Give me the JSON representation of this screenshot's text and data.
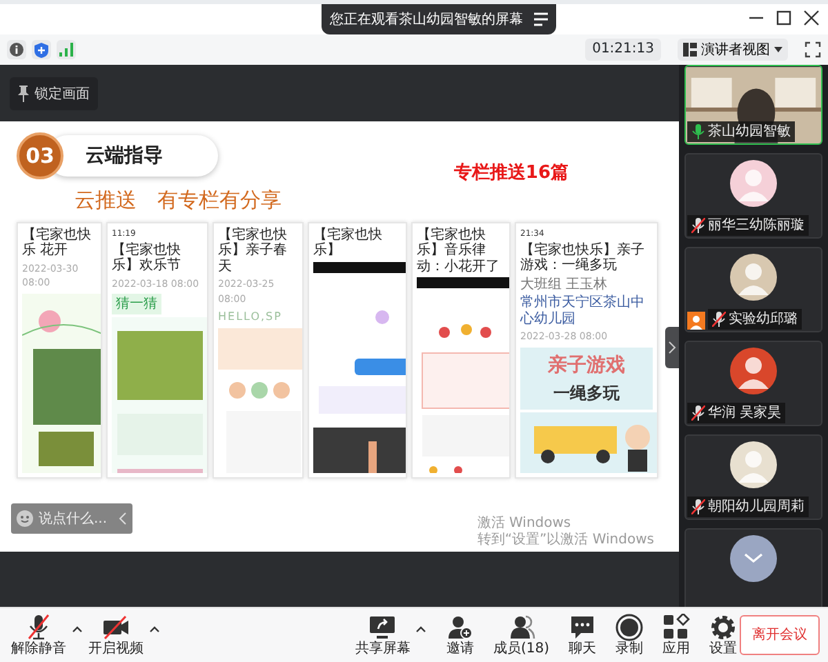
{
  "banner": {
    "text": "您正在观看茶山幼园智敏的屏幕"
  },
  "toolbar": {
    "timer": "01:21:13",
    "view": "演讲者视图"
  },
  "lock_button": {
    "label": "锁定画面"
  },
  "slide": {
    "number": "03",
    "section": "云端指导",
    "subtitle": "云推送　有专栏有分享",
    "highlight": "专栏推送16篇",
    "articles": [
      {
        "title": "【宅家也快乐 花开",
        "date": "2022-03-30 08:00"
      },
      {
        "status_time": "11:19",
        "title": "【宅家也快乐】欢乐节",
        "date": "2022-03-18 08:00",
        "tag": "猜一猜"
      },
      {
        "title": "【宅家也快乐】亲子春天",
        "date": "2022-03-25 08:00",
        "tag": "HELLO,SP"
      },
      {
        "title": "【宅家也快乐】"
      },
      {
        "title": "【宅家也快乐】音乐律动：小花开了"
      },
      {
        "status_time": "21:34",
        "title": "【宅家也快乐】亲子游戏：一绳多玩",
        "author": "大班组 王玉林",
        "org": "常州市天宁区茶山中心幼儿园",
        "date": "2022-03-28 08:00",
        "poster": [
          "亲子游戏",
          "一绳多玩"
        ]
      }
    ],
    "watermark": [
      "激活 Windows",
      "转到“设置”以激活 Windows"
    ]
  },
  "chat": {
    "placeholder": "说点什么..."
  },
  "participants": [
    {
      "name": "茶山幼园智敏",
      "video": true,
      "muted": false,
      "host_badge": false
    },
    {
      "name": "丽华三幼陈丽璇",
      "video": false,
      "muted": true,
      "host_badge": false
    },
    {
      "name": "实验幼邱璐",
      "video": false,
      "muted": true,
      "host_badge": true
    },
    {
      "name": "华润 吴家昊",
      "video": false,
      "muted": true,
      "host_badge": false
    },
    {
      "name": "朝阳幼儿园周莉",
      "video": false,
      "muted": true,
      "host_badge": false
    }
  ],
  "controls": [
    {
      "kind": "mic",
      "label": "解除静音",
      "off": true,
      "menu": true
    },
    {
      "kind": "camera",
      "label": "开启视频",
      "off": true,
      "menu": true
    },
    {
      "kind": "share",
      "label": "共享屏幕",
      "off": false,
      "menu": true
    },
    {
      "kind": "invite",
      "label": "邀请",
      "off": false,
      "menu": false
    },
    {
      "kind": "members",
      "label": "成员(18)",
      "off": false,
      "menu": false
    },
    {
      "kind": "chat",
      "label": "聊天",
      "off": false,
      "menu": false
    },
    {
      "kind": "record",
      "label": "录制",
      "off": false,
      "menu": false
    },
    {
      "kind": "apps",
      "label": "应用",
      "off": false,
      "menu": false
    },
    {
      "kind": "settings",
      "label": "设置",
      "off": false,
      "menu": false
    }
  ],
  "leave_button": {
    "label": "离开会议"
  }
}
